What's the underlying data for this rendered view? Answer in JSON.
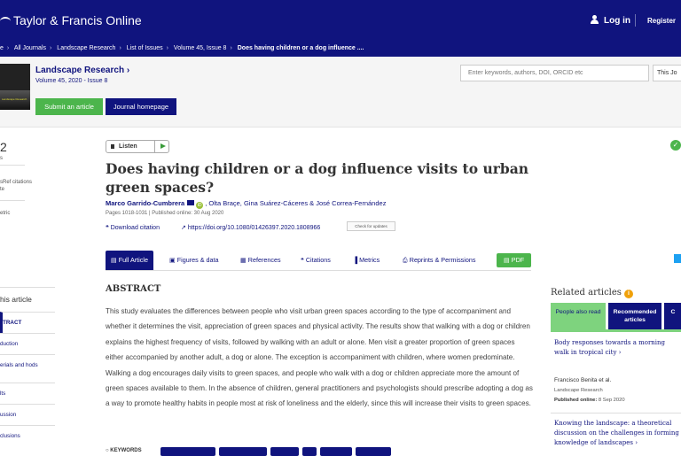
{
  "header": {
    "logo": "Taylor & Francis Online",
    "login": "Log in",
    "register": "Register"
  },
  "breadcrumb": [
    "e",
    "All Journals",
    "Landscape Research",
    "List of Issues",
    "Volume 45, Issue 8",
    "Does having children or a dog influence ...."
  ],
  "journal": {
    "cover_text": "Landscape Research",
    "name": "Landscape Research ›",
    "volume": "Volume 45, 2020 - Issue 8",
    "submit_label": "Submit an article",
    "homepage_label": "Journal homepage",
    "search_placeholder": "Enter keywords, authors, DOI, ORCID etc",
    "search_scope": "This Jo"
  },
  "metrics": {
    "views_count": "2",
    "views_label": "s",
    "crossref_label": "sRef citations",
    "crossref_suffix": "te",
    "altmetric_label": "etric"
  },
  "article": {
    "listen_label": "Listen",
    "title": "Does having children or a dog influence visits to urban green spaces?",
    "authors_first": "Marco Garrido-Cumbrera",
    "authors_rest": ", Olta Braçe, Gina Suárez-Cáceres & José Correa-Fernández",
    "pages": "Pages 1018-1031 | Published online: 30 Aug 2020",
    "download_citation": "❝ Download citation",
    "doi": "https://doi.org/10.1080/01426397.2020.1808966",
    "check_updates": "Check for updates",
    "check_badge": "✓"
  },
  "tabs": [
    {
      "label": "▤ Full Article"
    },
    {
      "label": "▣ Figures & data"
    },
    {
      "label": "▦ References"
    },
    {
      "label": "❝ Citations"
    },
    {
      "label": "▐ Metrics"
    },
    {
      "label": "⎙ Reprints & Permissions"
    },
    {
      "label": "▤ PDF"
    }
  ],
  "abstract": {
    "heading": "ABSTRACT",
    "text": "This study evaluates the differences between people who visit urban green spaces according to the type of accompaniment and whether it determines the visit, appreciation of green spaces and physical activity. The results show that walking with a dog or children explains the highest frequency of visits, followed by walking with an adult or alone. Men visit a greater proportion of green spaces either accompanied by another adult, a dog or alone. The exception is accompaniment with children, where women predominate. Walking a dog encourages daily visits to green spaces, and people who walk with a dog or children appreciate more the amount of green spaces available to them. In the absence of children, general practitioners and psychologists should prescribe adopting a dog as a way to promote healthy habits in people most at risk of loneliness and the elderly, since this will increase their visits to green spaces."
  },
  "keywords": {
    "label": "○ KEYWORDS"
  },
  "toc": {
    "heading": "his article",
    "items": [
      "TRACT",
      "duction",
      "erials and hods",
      "lts",
      "ussion",
      "clusions"
    ]
  },
  "related": {
    "heading": "Related articles",
    "info_icon": "i",
    "tab_people": "People also read",
    "tab_recommended": "Recommended articles",
    "tab_cited": "C",
    "item1_title": "Body responses towards a morning walk in tropical city ›",
    "item1_author": "Francisco Benita et al.",
    "item1_journal": "Landscape Research",
    "item1_date_label": "Published online:",
    "item1_date": " 8 Sep 2020",
    "item2_title": "Knowing the landscape: a theoretical discussion on the challenges in forming knowledge of landscapes ›"
  },
  "colors": {
    "brand_navy": "#10147e",
    "accent_green": "#4cb54c",
    "related_green": "#7ed37e",
    "info_orange": "#f0a10a"
  }
}
